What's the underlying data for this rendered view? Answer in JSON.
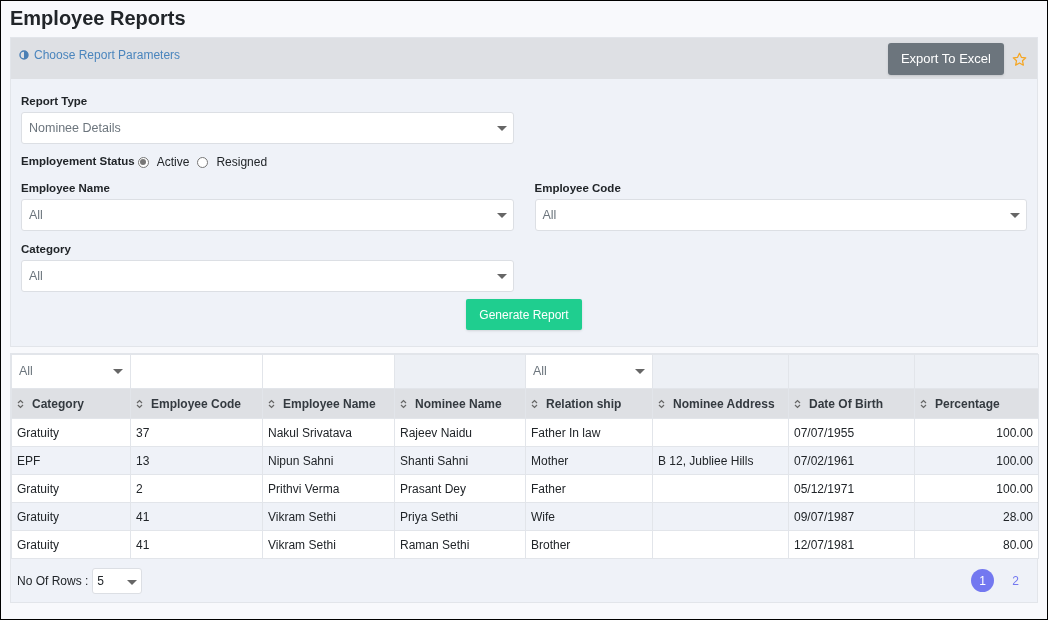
{
  "page_title": "Employee Reports",
  "panel": {
    "title": "Choose Report Parameters",
    "export_button": "Export To Excel",
    "favorite": false
  },
  "form": {
    "report_type": {
      "label": "Report Type",
      "value": "Nominee Details"
    },
    "employment_status": {
      "label": "Employement Status",
      "options": [
        {
          "label": "Active",
          "selected": true
        },
        {
          "label": "Resigned",
          "selected": false
        }
      ]
    },
    "employee_name": {
      "label": "Employee Name",
      "value": "All"
    },
    "employee_code": {
      "label": "Employee Code",
      "value": "All"
    },
    "category": {
      "label": "Category",
      "value": "All"
    },
    "generate_button": "Generate Report"
  },
  "table": {
    "columns": [
      {
        "label": "Category",
        "filter": {
          "kind": "select",
          "value": "All"
        },
        "kind": "text"
      },
      {
        "label": "Employee Code",
        "filter": {
          "kind": "text"
        },
        "kind": "text"
      },
      {
        "label": "Employee Name",
        "filter": {
          "kind": "text"
        },
        "kind": "text"
      },
      {
        "label": "Nominee Name",
        "filter": {
          "kind": "none"
        },
        "kind": "text"
      },
      {
        "label": "Relation ship",
        "filter": {
          "kind": "select",
          "value": "All"
        },
        "kind": "text"
      },
      {
        "label": "Nominee Address",
        "filter": {
          "kind": "none"
        },
        "kind": "text"
      },
      {
        "label": "Date Of Birth",
        "filter": {
          "kind": "none"
        },
        "kind": "text"
      },
      {
        "label": "Percentage",
        "filter": {
          "kind": "none"
        },
        "kind": "number"
      }
    ],
    "rows": [
      [
        "Gratuity",
        "37",
        "Nakul Srivatava",
        "Rajeev Naidu",
        "Father In law",
        "",
        "07/07/1955",
        "100.00"
      ],
      [
        "EPF",
        "13",
        "Nipun Sahni",
        "Shanti Sahni",
        "Mother",
        "B 12, Jubliee Hills",
        "07/02/1961",
        "100.00"
      ],
      [
        "Gratuity",
        "2",
        "Prithvi Verma",
        "Prasant Dey",
        "Father",
        "",
        "05/12/1971",
        "100.00"
      ],
      [
        "Gratuity",
        "41",
        "Vikram Sethi",
        "Priya Sethi",
        "Wife",
        "",
        "09/07/1987",
        "28.00"
      ],
      [
        "Gratuity",
        "41",
        "Vikram Sethi",
        "Raman Sethi",
        "Brother",
        "",
        "12/07/1981",
        "80.00"
      ]
    ]
  },
  "footer": {
    "rows_label": "No Of Rows :",
    "rows_value": "5",
    "pages": [
      {
        "label": "1",
        "selected": true
      },
      {
        "label": "2",
        "selected": false
      }
    ]
  }
}
